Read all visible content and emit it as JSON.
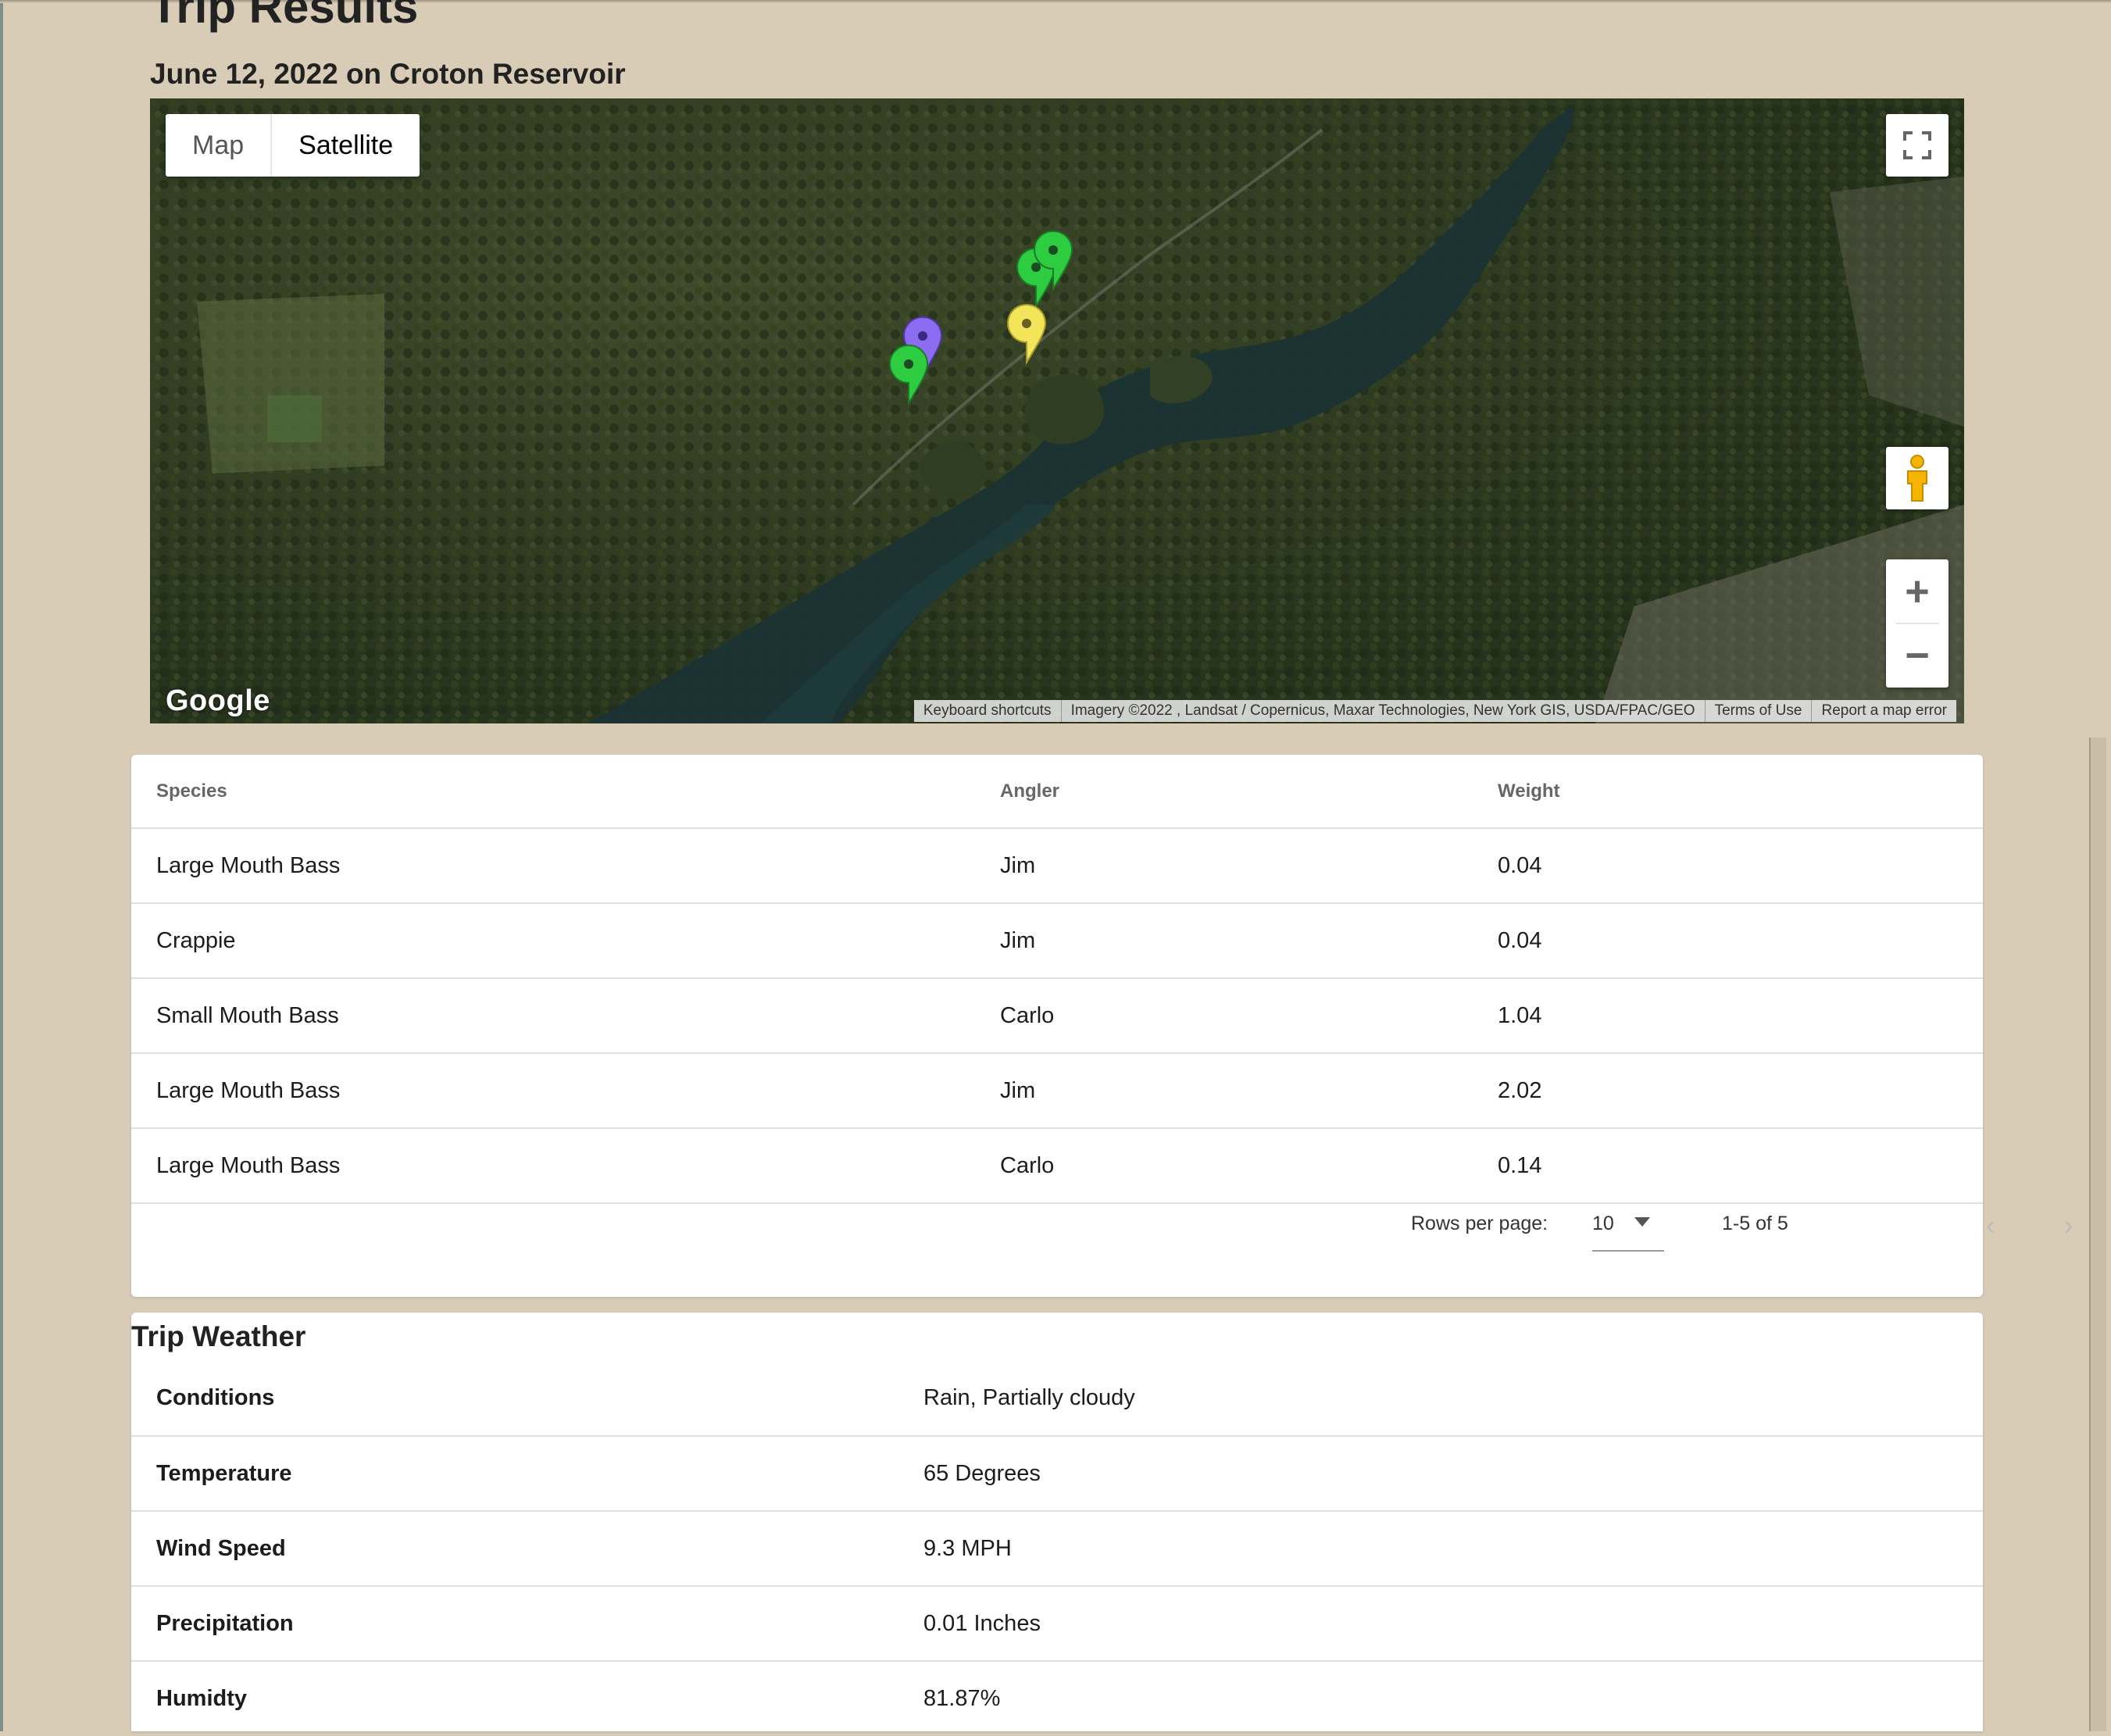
{
  "page": {
    "title": "Trip Results",
    "subtitle": "June 12, 2022 on Croton Reservoir"
  },
  "map": {
    "type_options": [
      "Map",
      "Satellite"
    ],
    "selected_type": "Satellite",
    "logo": "Google",
    "attribution": [
      "Keyboard shortcuts",
      "Imagery ©2022 , Landsat / Copernicus, Maxar Technologies, New York GIS, USDA/FPAC/GEO",
      "Terms of Use",
      "Report a map error"
    ],
    "zoom_in": "+",
    "zoom_out": "−",
    "markers": [
      {
        "color": "#2ecc40",
        "icon": "map-pin-icon"
      },
      {
        "color": "#2ecc40",
        "icon": "map-pin-icon"
      },
      {
        "color": "#f3e55a",
        "icon": "map-pin-icon"
      },
      {
        "color": "#8c6cf0",
        "icon": "map-pin-icon"
      },
      {
        "color": "#2ecc40",
        "icon": "map-pin-icon"
      }
    ]
  },
  "catch_table": {
    "headers": [
      "Species",
      "Angler",
      "Weight"
    ],
    "rows": [
      [
        "Large Mouth Bass",
        "Jim",
        "0.04"
      ],
      [
        "Crappie",
        "Jim",
        "0.04"
      ],
      [
        "Small Mouth Bass",
        "Carlo",
        "1.04"
      ],
      [
        "Large Mouth Bass",
        "Jim",
        "2.02"
      ],
      [
        "Large Mouth Bass",
        "Carlo",
        "0.14"
      ]
    ],
    "pagination": {
      "rows_per_page_label": "Rows per page:",
      "rows_per_page": "10",
      "range": "1-5 of 5",
      "prev": "‹",
      "next": "›"
    }
  },
  "weather": {
    "title": "Trip Weather",
    "rows": [
      {
        "label": "Conditions",
        "value": "Rain, Partially cloudy"
      },
      {
        "label": "Temperature",
        "value": "65 Degrees"
      },
      {
        "label": "Wind Speed",
        "value": "9.3 MPH"
      },
      {
        "label": "Precipitation",
        "value": "0.01 Inches"
      },
      {
        "label": "Humidty",
        "value": "81.87%"
      }
    ]
  }
}
